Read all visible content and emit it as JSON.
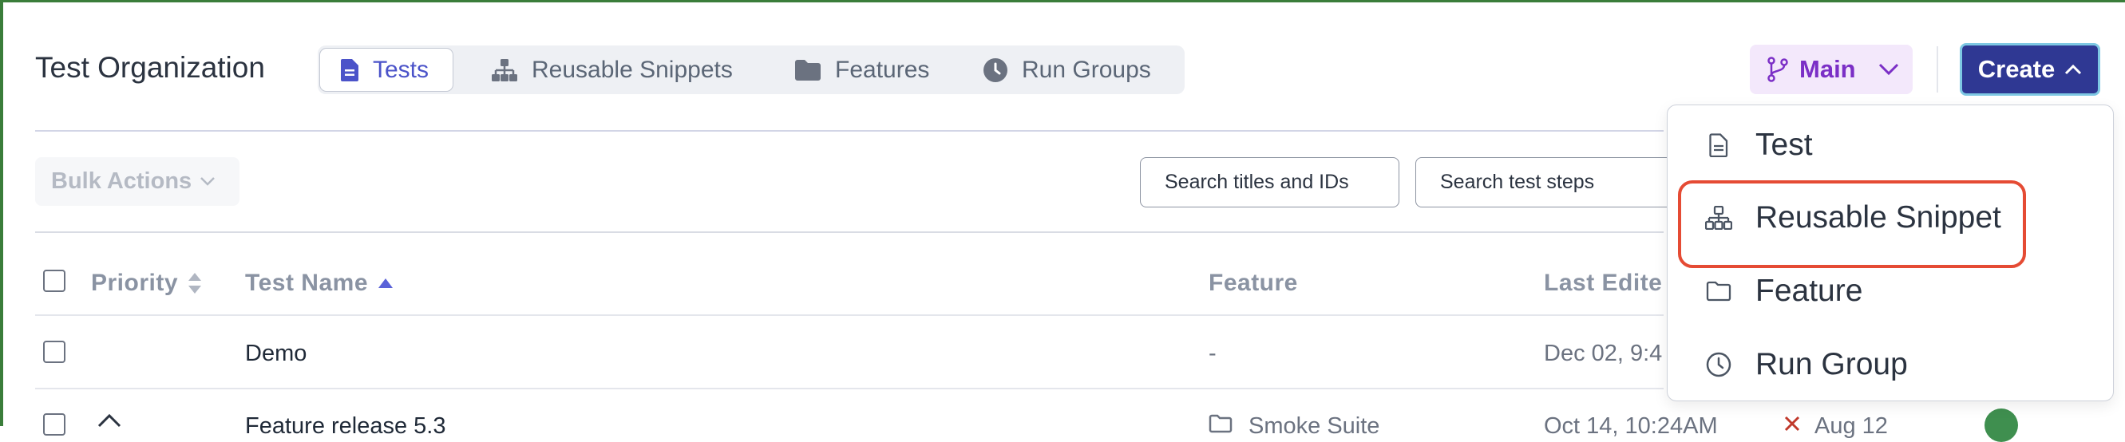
{
  "header": {
    "org_title": "Test Organization",
    "tabs": [
      {
        "label": "Tests",
        "icon": "document-icon",
        "active": true
      },
      {
        "label": "Reusable Snippets",
        "icon": "sitemap-icon",
        "active": false
      },
      {
        "label": "Features",
        "icon": "folder-icon",
        "active": false
      },
      {
        "label": "Run Groups",
        "icon": "clock-icon",
        "active": false
      }
    ],
    "branch_label": "Main",
    "create_label": "Create"
  },
  "toolbar": {
    "bulk_actions_label": "Bulk Actions",
    "search_titles_placeholder": "Search titles and IDs",
    "search_steps_placeholder": "Search test steps"
  },
  "table": {
    "columns": {
      "priority": "Priority",
      "test_name": "Test Name",
      "feature": "Feature",
      "last_edited": "Last Edite"
    },
    "rows": [
      {
        "name": "Demo",
        "feature": "-",
        "last_edited": "Dec 02, 9:4"
      },
      {
        "name": "Feature release 5.3",
        "feature": "Smoke Suite",
        "last_edited": "Oct 14, 10:24AM",
        "extra": "Aug 12"
      }
    ]
  },
  "create_menu": {
    "items": [
      {
        "label": "Test",
        "icon": "document-icon"
      },
      {
        "label": "Reusable Snippet",
        "icon": "sitemap-icon"
      },
      {
        "label": "Feature",
        "icon": "folder-icon"
      },
      {
        "label": "Run Group",
        "icon": "clock-icon"
      }
    ]
  },
  "colors": {
    "accent": "#4b53c9",
    "create_bg": "#2f3893",
    "branch_fg": "#7b2fc6",
    "highlight": "#e54b34"
  }
}
